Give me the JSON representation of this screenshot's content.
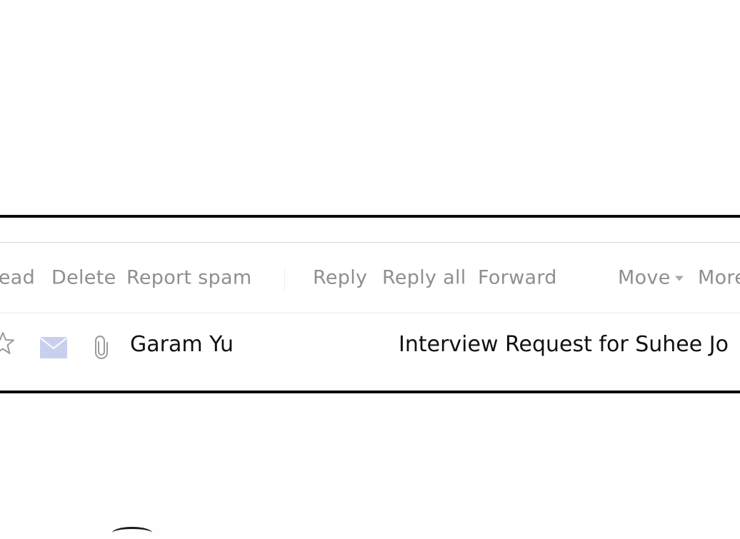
{
  "toolbar": {
    "read": "Read",
    "delete": "Delete",
    "report_spam": "Report spam",
    "reply": "Reply",
    "reply_all": "Reply all",
    "forward": "Forward",
    "move": "Move",
    "more": "More"
  },
  "email": {
    "sender": "Garam Yu",
    "subject": "Interview Request for Suhee Jo",
    "starred": false,
    "has_attachment": true,
    "icons": {
      "star": "star-icon",
      "mail": "mail-icon",
      "attachment": "paperclip-icon"
    }
  },
  "colors": {
    "toolbar_text": "#8f8f8f",
    "mail_icon": "#c9d0ef",
    "border": "#0b0b0b"
  }
}
